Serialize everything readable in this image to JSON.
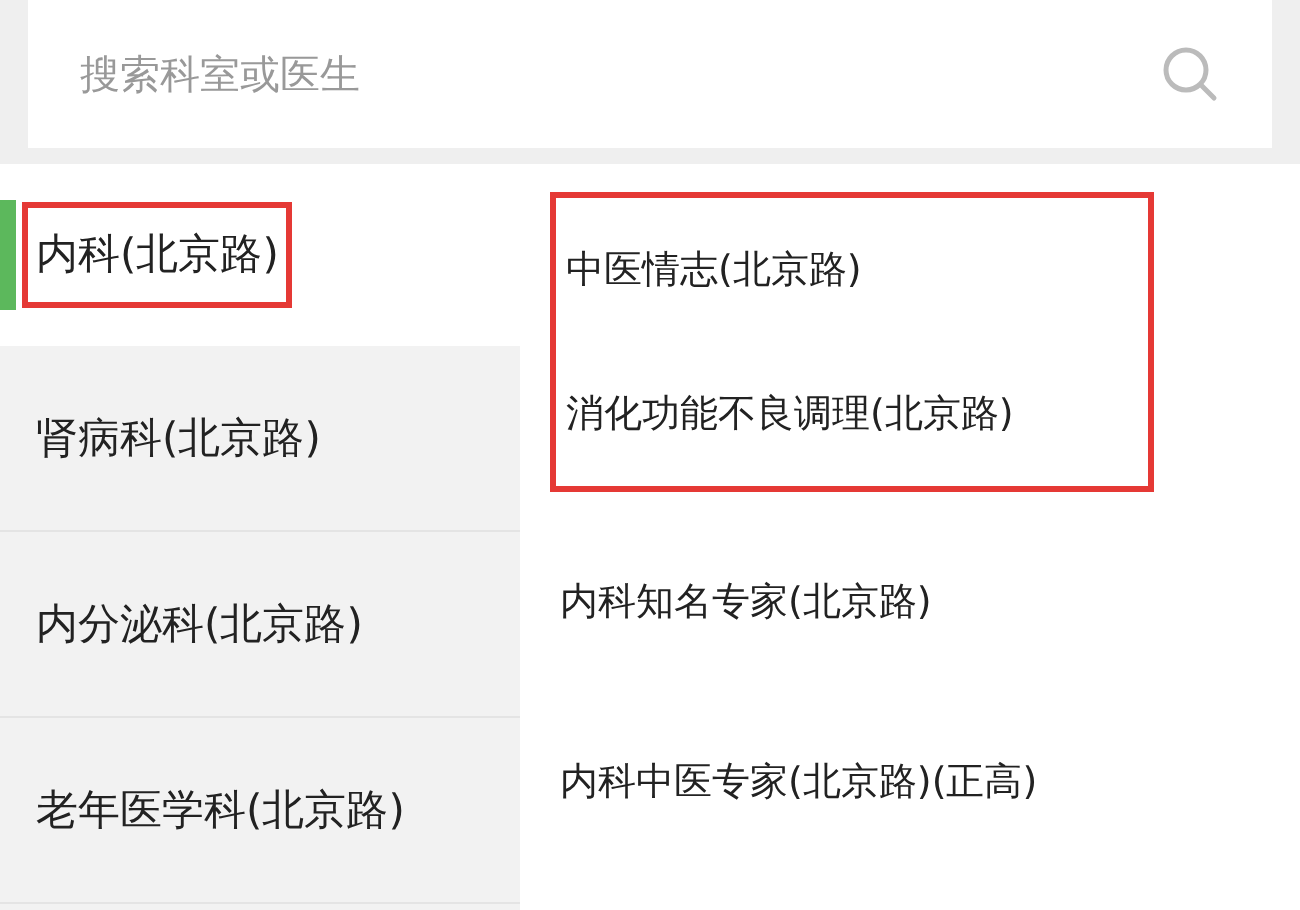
{
  "search": {
    "placeholder": "搜索科室或医生"
  },
  "departments": [
    {
      "label": "内科(北京路)",
      "selected": true,
      "highlighted": true
    },
    {
      "label": "肾病科(北京路)",
      "selected": false,
      "highlighted": false
    },
    {
      "label": "内分泌科(北京路)",
      "selected": false,
      "highlighted": false
    },
    {
      "label": "老年医学科(北京路)",
      "selected": false,
      "highlighted": false
    }
  ],
  "clinics": [
    {
      "label": "中医情志(北京路)",
      "highlighted": true
    },
    {
      "label": "消化功能不良调理(北京路)",
      "highlighted": true
    },
    {
      "label": "内科知名专家(北京路)",
      "highlighted": false
    },
    {
      "label": "内科中医专家(北京路)(正高)",
      "highlighted": false
    }
  ]
}
